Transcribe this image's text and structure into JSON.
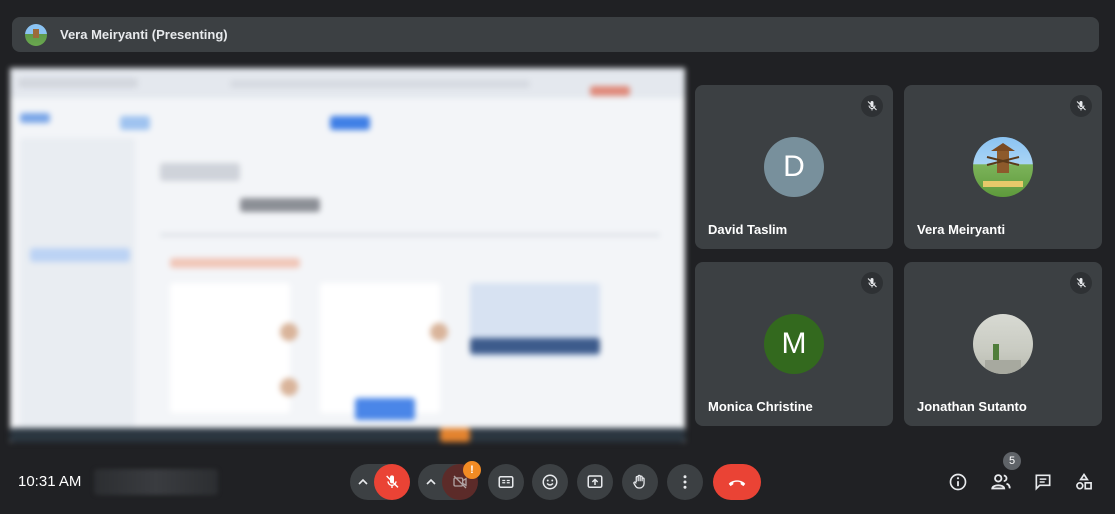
{
  "header": {
    "presenter_label": "Vera Meiryanti (Presenting)"
  },
  "participants": [
    {
      "name": "David Taslim",
      "initial": "D",
      "avatar_color": "#78909c"
    },
    {
      "name": "Vera Meiryanti",
      "initial": "",
      "avatar_color": "#8bc3f2"
    },
    {
      "name": "Monica Christine",
      "initial": "M",
      "avatar_color": "#33691e"
    },
    {
      "name": "Jonathan Sutanto",
      "initial": "",
      "avatar_color": "#cfd2c8"
    }
  ],
  "controls": {
    "time": "10:31 AM",
    "camera_warning_badge": "!",
    "people_count": "5"
  },
  "colors": {
    "background": "#202124",
    "surface": "#3c4043",
    "danger": "#ea4335",
    "warning": "#f28b24"
  },
  "icons": {
    "mic": "mic-off-icon",
    "camera": "camera-off-icon",
    "captions": "captions-icon",
    "reactions": "emoji-icon",
    "present": "present-screen-icon",
    "hand": "raise-hand-icon",
    "more": "more-vert-icon",
    "end": "end-call-icon",
    "info": "info-icon",
    "people": "people-icon",
    "chat": "chat-icon",
    "activities": "activities-icon"
  }
}
